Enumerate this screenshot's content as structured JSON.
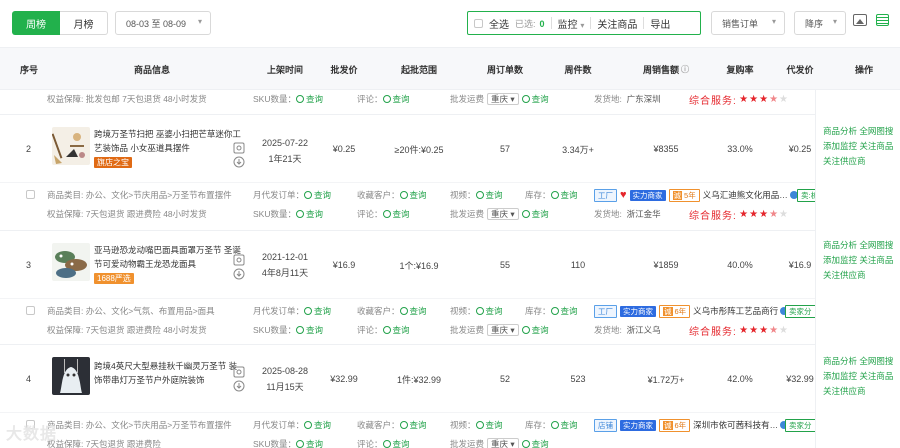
{
  "toolbar": {
    "tab_week": "周榜",
    "tab_month": "月榜",
    "date_range": "08-03 至 08-09",
    "select_all": "全选",
    "selected_label": "已选:",
    "selected_count": "0",
    "monitor": "监控",
    "follow": "关注商品",
    "export": "导出",
    "sort_field": "销售订单",
    "sort_order": "降序"
  },
  "columns": [
    "序号",
    "商品信息",
    "上架时间",
    "批发价",
    "起批范围",
    "周订单数",
    "周件数",
    "周销售额",
    "复购率",
    "代发价",
    "操作"
  ],
  "labels": {
    "guarantee": "权益保障:",
    "sku": "SKU数量：",
    "query": "查询",
    "comment": "评论：",
    "shipping": "批发运费",
    "ship_from": "发货地:",
    "service": "综合服务:",
    "category": "商品类目:",
    "monthly_orders": "月代发订单：",
    "favorite": "收藏客户：",
    "video": "视频：",
    "stock": "库存：",
    "region": "重庆"
  },
  "top_strip": {
    "guarantee": "批发包邮   7天包退货   48小时发货",
    "ship_from": "广东深圳"
  },
  "products": [
    {
      "index": "2",
      "title": "跨境万圣节扫把 巫婆小扫把芒草迷你工艺装饰品 小女巫道具摆件",
      "tag": "旗店之宝",
      "tag_color": "#e07714",
      "list_date": "2025-07-22",
      "list_age": "1年21天",
      "price": "¥0.25",
      "moq": "≥20件:¥0.25",
      "week_orders": "57",
      "week_pieces": "3.34万+",
      "week_sales": "¥8355",
      "repurchase": "33.0%",
      "dropship": "¥0.25",
      "category": "办公、文化>节庆用品>万圣节布置摆件",
      "guarantee": "7天包退货   跟进费险   48小时发货",
      "shop": "义乌汇迪熊文化用品…",
      "ship_from": "浙江金华",
      "badge1": "工厂",
      "years": "5年",
      "seller_btn": "卖:析",
      "stars": 3.5
    },
    {
      "index": "3",
      "title": "亚马逊恐龙动嘴巴面具面罩万圣节 圣诞节可爱动物霸王龙恐龙面具",
      "tag": "1688严选",
      "tag_color": "#f0912e",
      "list_date": "2021-12-01",
      "list_age": "4年8月11天",
      "price": "¥16.9",
      "moq": "1个:¥16.9",
      "week_orders": "55",
      "week_pieces": "110",
      "week_sales": "¥1859",
      "repurchase": "40.0%",
      "dropship": "¥16.9",
      "category": "办公、文化>气氛、布置用品>面具",
      "guarantee": "7天包退货   跟进费险   48小时发货",
      "shop": "义乌市彤阵工艺品商行",
      "ship_from": "浙江义乌",
      "badge1": "工厂",
      "years": "6年",
      "seller_btn": "卖家分",
      "stars": 3.5
    },
    {
      "index": "4",
      "title": "跨境4英尺大型悬挂秋千幽灵万圣节 装饰带串灯万圣节户外庭院装饰",
      "tag": "",
      "tag_color": "",
      "list_date": "2025-08-28",
      "list_age": "11月15天",
      "price": "¥32.99",
      "moq": "1件:¥32.99",
      "week_orders": "52",
      "week_pieces": "523",
      "week_sales": "¥1.72万+",
      "repurchase": "42.0%",
      "dropship": "¥32.99",
      "category": "办公、文化>节庆用品>万圣节布置摆件",
      "guarantee": "7天包退货   跟进费险",
      "shop": "深圳市依可茜科技有…",
      "ship_from": "",
      "badge1": "店铺",
      "years": "6年",
      "seller_btn": "卖家分",
      "stars": 3.5
    }
  ],
  "actions": {
    "analysis": "商品分析",
    "search_img": "全网图搜",
    "add_monitor": "添加监控",
    "follow_item": "关注商品",
    "follow_supplier": "关注供应商"
  },
  "brand_badge": "实力商家",
  "watermark": "大数据"
}
